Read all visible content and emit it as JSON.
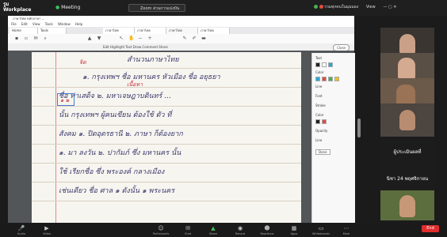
{
  "zoom": {
    "logo_line1": "รูม",
    "logo_line2": "Workplace",
    "meeting_label": "Meeting",
    "share_title": "Zoom ส่วนการแบ่งปัน",
    "top_right_text": "รวมทุกคนในมุมมอง",
    "top_right_view": "View"
  },
  "window": {
    "title": "ภาษาไทย หลักภาษา ...",
    "menu": [
      "File",
      "Edit",
      "View",
      "Tools",
      "Window",
      "Help"
    ],
    "tabs": [
      "Home",
      "Tools",
      "ภาษาไทย",
      "ภาษาไทย",
      "ภาษาไทย",
      "ภาษาไทย"
    ],
    "toolbar2_text": "Edit   Highlight   Text   Draw   Comment   Share",
    "close_label": "Close",
    "panel_labels": [
      "Text",
      "Color",
      "Line",
      "Font",
      "Stroke",
      "Color",
      "Opacity",
      "Line",
      "Done"
    ]
  },
  "document": {
    "heading": "สำนวนภาษาไทย",
    "lines": [
      "๑. กรุงเทพฯ ชื่อ มหานคร หัวเมือง ชื่อ อยุธยา",
      "ชื่อ ท่าเสด็จ ๒. มหาเจษฎาบดินทร์ ...",
      "นั้น กรุงเทพฯ ผู้คนเขียน ต้องใช้ ตัว ที่",
      "สังคม ๑. ปิดอุดรธานี ๒. ภาษา ก็ต้องยาก",
      "๑. มา ลงวัน ๒. ปากัมภ์ ซึ่ง มหานคร นั้น",
      "ใช้ เรียกชื่อ ซึ่ง พระองค์ กลางเมือง",
      "เช่นเดียว ชื่อ ศาล ๑ ดังนั้น ๑ พระนคร"
    ],
    "annotations": [
      "จิต",
      "เนื้อหา",
      "๑ ๒"
    ]
  },
  "participants": [
    {
      "name": "",
      "kind": "video"
    },
    {
      "name": "",
      "kind": "video"
    },
    {
      "name": "",
      "kind": "video"
    },
    {
      "name": "",
      "kind": "video"
    },
    {
      "name": "ผู้ประเมินผลที่",
      "kind": "name"
    },
    {
      "name": "นิชา 24 พฤศจิกายน",
      "kind": "name"
    },
    {
      "name": "",
      "kind": "video"
    }
  ],
  "bottom_bar": {
    "items": [
      "Audio",
      "Video",
      "Participants",
      "Chat",
      "Share",
      "Record",
      "Reactions",
      "Apps",
      "Whiteboards",
      "More",
      "End"
    ]
  },
  "colors": {
    "zoom_bg": "#1f1f1f",
    "pen_blue": "#3b3a6e",
    "pen_red": "#c0303a",
    "end_red": "#e02d2d"
  }
}
